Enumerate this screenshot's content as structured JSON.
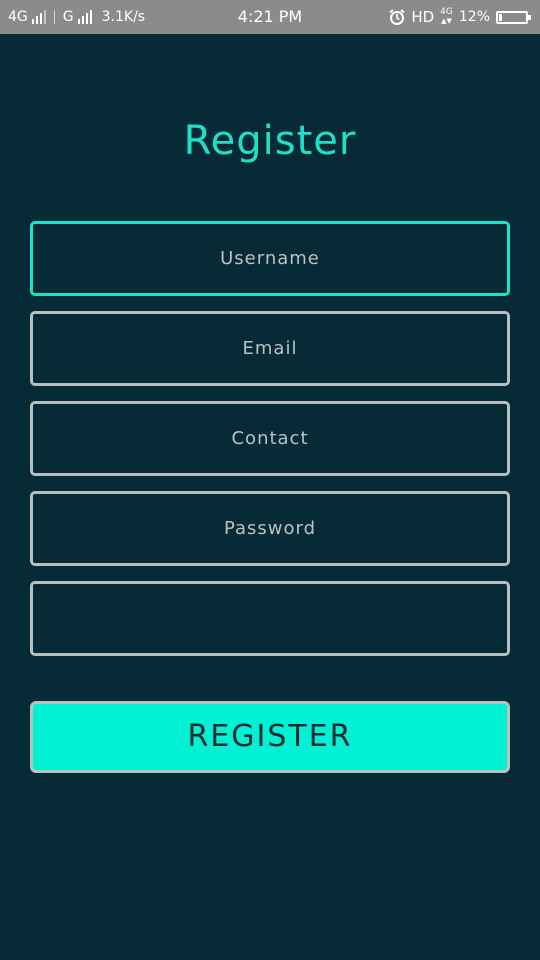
{
  "status_bar": {
    "network1": "4G",
    "network2": "G",
    "speed": "3.1K/s",
    "time": "4:21 PM",
    "hd": "HD",
    "lte_top": "4G",
    "lte_bottom": "▲▼",
    "battery": "12%",
    "battery_level": 0.12,
    "icons": [
      "signal-icon",
      "alarm-icon",
      "battery-icon"
    ]
  },
  "page": {
    "title": "Register"
  },
  "form": {
    "username_placeholder": "Username",
    "email_placeholder": "Email",
    "contact_placeholder": "Contact",
    "password_placeholder": "Password",
    "confirm_placeholder": "",
    "submit_label": "REGISTER"
  },
  "colors": {
    "background": "#062a36",
    "accent": "#1ee0c8",
    "button": "#00f1d3",
    "field_border": "#b6c1bf",
    "status_bar": "#8b8b8b"
  }
}
